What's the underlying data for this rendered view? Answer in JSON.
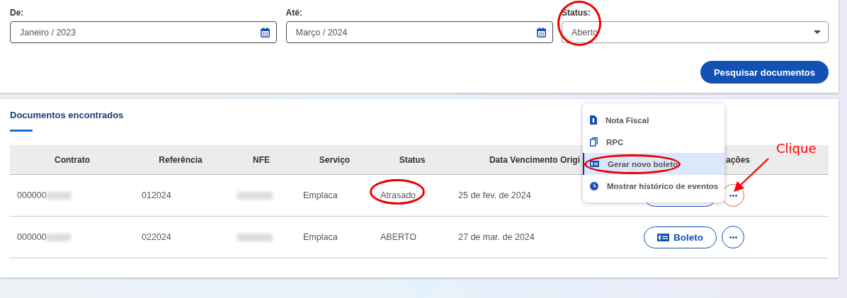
{
  "filters": {
    "from": {
      "label": "De:",
      "value": "Janeiro / 2023"
    },
    "to": {
      "label": "Até:",
      "value": "Março / 2024"
    },
    "status": {
      "label": "Status:",
      "value": "Aberto",
      "circled": true
    }
  },
  "search_button": "Pesquisar documentos",
  "results": {
    "title": "Documentos encontrados",
    "columns": [
      "Contrato",
      "Referência",
      "NFE",
      "Serviço",
      "Status",
      "Data Vencimento Origi",
      "ações"
    ],
    "rows": [
      {
        "contrato": "000000",
        "referencia": "012024",
        "servico": "Emplaca",
        "status": "Atrasado",
        "status_circled": true,
        "vencimento": "25 de fev. de 2024",
        "boleto_label": null,
        "more_focused": true
      },
      {
        "contrato": "000000",
        "referencia": "022024",
        "servico": "Emplaca",
        "status": "ABERTO",
        "status_circled": false,
        "vencimento": "27 de mar. de 2024",
        "boleto_label": "Boleto",
        "more_focused": false
      }
    ]
  },
  "menu": {
    "items": [
      {
        "kind": "invoice",
        "label": "Nota Fiscal",
        "selected": false,
        "circled": false
      },
      {
        "kind": "copy",
        "label": "RPC",
        "selected": false,
        "circled": false
      },
      {
        "kind": "boleto",
        "label": "Gerar novo boleto",
        "selected": true,
        "circled": true
      },
      {
        "kind": "history",
        "label": "Mostrar histórico de eventos",
        "selected": false,
        "circled": false
      }
    ]
  },
  "annotation": {
    "label": "Clique"
  }
}
